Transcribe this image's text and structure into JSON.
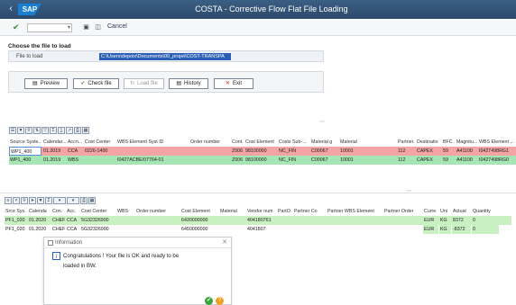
{
  "header": {
    "back_icon": "back-arrow-icon",
    "logo": "SAP",
    "title": "COSTA - Corrective Flow Flat File Loading"
  },
  "toolbar": {
    "cancel_label": "Cancel"
  },
  "file_section": {
    "title": "Choose the file to load",
    "file_label": "File to load",
    "file_value": "C:\\Users\\depoix\\Documents\\00_projet\\COST-TRANSPA"
  },
  "buttons": {
    "preview": "Preview",
    "check_file": "Check file",
    "load_file": "Load file",
    "history": "History",
    "exit": "Exit"
  },
  "grid1": {
    "columns": [
      "Source Syste...",
      "Calendar...",
      "Accn...",
      "Cost Center",
      "WBS Element Syst ID",
      "Order number",
      "Cont...",
      "Cost Element",
      "Costs Sub-...",
      "Material g",
      "Material",
      "Partner...",
      "Destinatio",
      "BFC ...",
      "Magnitu...",
      "WBS Element ..."
    ],
    "rows": [
      [
        "WP1_400",
        "01.2019",
        "CCA",
        "0226-1400",
        "",
        "",
        "Z006",
        "98100000",
        "NC_FIN",
        "C00067",
        "10001",
        "112",
        "CAPEX",
        "59",
        "A41100",
        "I0427498RG1"
      ],
      [
        "WP1_400",
        "01.2019",
        "WBS",
        "",
        "I0427ACBE/07764-01",
        "",
        "Z006",
        "98100000",
        "NC_FIN",
        "C00067",
        "10001",
        "112",
        "CAPEX",
        "59",
        "A41100",
        "I0427498RG0"
      ]
    ]
  },
  "grid2": {
    "columns": [
      "Srce Sys.",
      "Calenda",
      "Con.",
      "Acc.",
      "Cost Center",
      "WBS",
      "Order number",
      "Cost Element",
      "Material",
      "Vendor num",
      "PartO",
      "Partner Co",
      "Partner WBS Element",
      "Partner Order",
      "Curre",
      "Uni",
      "Actual",
      "Quantity"
    ],
    "rows": [
      [
        "PF1_020",
        "01.2020",
        "CHEF",
        "CCA",
        "5G32326900",
        "",
        "",
        "6430000000",
        "",
        "404180761",
        "",
        "",
        "",
        "",
        "EUR",
        "KG",
        "8372",
        "0"
      ],
      [
        "PF1_020",
        "01.2020",
        "CHEF",
        "CCA",
        "5G32326900",
        "",
        "",
        "6450000000",
        "",
        "4041807",
        "",
        "",
        "",
        "",
        "EUR",
        "KG",
        "-8372",
        "0"
      ]
    ]
  },
  "dialog": {
    "title": "Information",
    "message_line1": "Congratulations ! Your file is OK and ready to be",
    "message_line2": "loaded in BW."
  }
}
